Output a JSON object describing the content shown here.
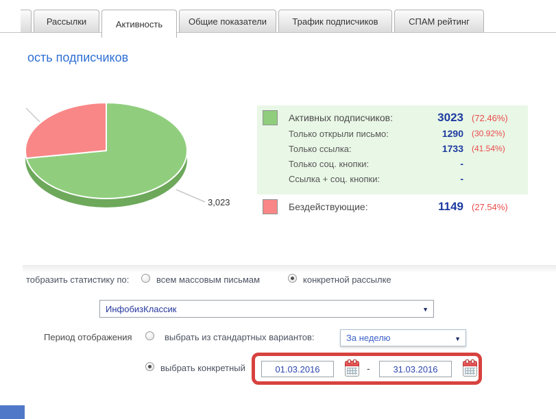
{
  "tabs": {
    "items": [
      {
        "label": "Рассылки",
        "active": false
      },
      {
        "label": "Активность",
        "active": true
      },
      {
        "label": "Общие показатели",
        "active": false
      },
      {
        "label": "Трафик подписчиков",
        "active": false
      },
      {
        "label": "СПАМ рейтинг",
        "active": false
      }
    ]
  },
  "heading": "ость подписчиков",
  "chart_data": {
    "type": "pie",
    "labels": [
      "Активных подписчиков",
      "Бездействующие"
    ],
    "values": [
      3023,
      1149
    ],
    "percentages": [
      72.46,
      27.54
    ],
    "colors": [
      "#90ce7e",
      "#f98787"
    ],
    "start_angle": "top",
    "point_label": "3,023",
    "legend_position": "right"
  },
  "legend": {
    "active": {
      "label": "Активных подписчиков:",
      "value": "3023",
      "percent": "(72.46%)",
      "sub_rows": [
        {
          "label": "Только открыли письмо:",
          "value": "1290",
          "percent": "(30.92%)"
        },
        {
          "label": "Только ссылка:",
          "value": "1733",
          "percent": "(41.54%)"
        },
        {
          "label": "Только соц. кнопки:",
          "value": "-",
          "percent": ""
        },
        {
          "label": "Ссылка + соц. кнопки:",
          "value": "-",
          "percent": ""
        }
      ]
    },
    "inactive": {
      "label": "Бездействующие:",
      "value": "1149",
      "percent": "(27.54%)"
    }
  },
  "filters": {
    "stats_by_label": "тобразить статистику по:",
    "radio_all_mass": "всем массовым письмам",
    "radio_specific": "конкретной рассылке",
    "campaign_select_value": "ИнфобизКлассик",
    "period_label": "Период отображения",
    "period_standard_label": "выбрать из стандартных вариантов:",
    "period_select_value": "За неделю",
    "period_custom_label": "выбрать конкретный",
    "date_from": "01.03.2016",
    "date_to": "31.03.2016",
    "date_separator": "-"
  },
  "colors": {
    "accent_blue_heading": "#2e6fd4",
    "value_navy": "#1c3aa0",
    "percent_red": "#e94b4b",
    "legend_bg": "#e9f7e6",
    "highlight_red": "#d7423e",
    "pie_green": "#90ce7e",
    "pie_red": "#f98787"
  }
}
